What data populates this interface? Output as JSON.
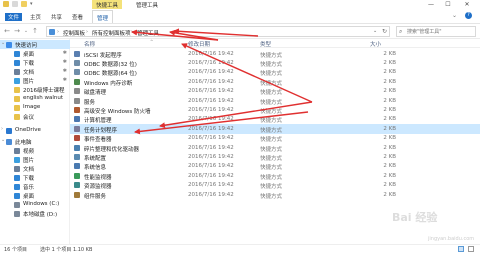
{
  "titlebar": {
    "tools_tab": "快捷工具",
    "title": "管理工具",
    "controls": [
      "—",
      "☐",
      "✕"
    ]
  },
  "ribbon": {
    "tabs": [
      "文件",
      "主页",
      "共享",
      "查看"
    ],
    "manage_tab": "管理"
  },
  "address": {
    "segments": [
      "控制面板",
      "所有控制面板项",
      "管理工具"
    ],
    "search_placeholder": "搜索\"管理工具\""
  },
  "columns": {
    "name": "名称",
    "date": "修改日期",
    "type": "类型",
    "size": "大小"
  },
  "sidebar": {
    "items": [
      {
        "label": "快速访问",
        "pinned": false,
        "selected": true,
        "color": "#3c8be8"
      },
      {
        "label": "桌面",
        "pinned": true,
        "selected": false,
        "color": "#2f86d6"
      },
      {
        "label": "下载",
        "pinned": true,
        "selected": false,
        "color": "#2f86d6"
      },
      {
        "label": "文档",
        "pinned": true,
        "selected": false,
        "color": "#6b7f99"
      },
      {
        "label": "图片",
        "pinned": true,
        "selected": false,
        "color": "#3ba0e0"
      },
      {
        "label": "2016级博士课程",
        "pinned": false,
        "selected": false,
        "color": "#e8c24a"
      },
      {
        "label": "english walnut",
        "pinned": false,
        "selected": false,
        "color": "#e8c24a"
      },
      {
        "label": "Image",
        "pinned": false,
        "selected": false,
        "color": "#e8c24a"
      },
      {
        "label": "会议",
        "pinned": false,
        "selected": false,
        "color": "#e8c24a"
      },
      {
        "label": "OneDrive",
        "pinned": false,
        "selected": false,
        "color": "#2a78d0"
      },
      {
        "label": "此电脑",
        "pinned": false,
        "selected": false,
        "color": "#4a8bd6"
      },
      {
        "label": "视频",
        "pinned": false,
        "selected": false,
        "color": "#6b7f99"
      },
      {
        "label": "图片",
        "pinned": false,
        "selected": false,
        "color": "#3ba0e0"
      },
      {
        "label": "文档",
        "pinned": false,
        "selected": false,
        "color": "#6b7f99"
      },
      {
        "label": "下载",
        "pinned": false,
        "selected": false,
        "color": "#2f86d6"
      },
      {
        "label": "音乐",
        "pinned": false,
        "selected": false,
        "color": "#2f86d6"
      },
      {
        "label": "桌面",
        "pinned": false,
        "selected": false,
        "color": "#2f86d6"
      },
      {
        "label": "Windows (C:)",
        "pinned": false,
        "selected": false,
        "color": "#7a8899"
      },
      {
        "label": "本地磁盘 (D:)",
        "pinned": false,
        "selected": false,
        "color": "#7a8899"
      }
    ]
  },
  "files": [
    {
      "name": "iSCSI 发起程序",
      "date": "2016/7/16 19:42",
      "type": "快捷方式",
      "size": "2 KB",
      "color": "#5a7fb0"
    },
    {
      "name": "ODBC 数据源(32 位)",
      "date": "2016/7/16 19:42",
      "type": "快捷方式",
      "size": "2 KB",
      "color": "#6f8da8"
    },
    {
      "name": "ODBC 数据源(64 位)",
      "date": "2016/7/16 19:42",
      "type": "快捷方式",
      "size": "2 KB",
      "color": "#6f8da8"
    },
    {
      "name": "Windows 内存诊断",
      "date": "2016/7/16 19:42",
      "type": "快捷方式",
      "size": "2 KB",
      "color": "#4d8a4d"
    },
    {
      "name": "磁盘清理",
      "date": "2016/7/16 19:42",
      "type": "快捷方式",
      "size": "2 KB",
      "color": "#8a8a8a"
    },
    {
      "name": "服务",
      "date": "2016/7/16 19:42",
      "type": "快捷方式",
      "size": "2 KB",
      "color": "#8a8a8a"
    },
    {
      "name": "高级安全 Windows 防火墙",
      "date": "2016/7/16 19:42",
      "type": "快捷方式",
      "size": "2 KB",
      "color": "#b0592e"
    },
    {
      "name": "计算机管理",
      "date": "2016/7/16 19:42",
      "type": "快捷方式",
      "size": "2 KB",
      "color": "#4a76b0"
    },
    {
      "name": "任务计划程序",
      "date": "2016/7/16 19:42",
      "type": "快捷方式",
      "size": "2 KB",
      "color": "#7a7a9a",
      "selected": true
    },
    {
      "name": "事件查看器",
      "date": "2016/7/16 19:42",
      "type": "快捷方式",
      "size": "2 KB",
      "color": "#b04a3a"
    },
    {
      "name": "碎片整理和优化驱动器",
      "date": "2016/7/16 19:42",
      "type": "快捷方式",
      "size": "2 KB",
      "color": "#4a80b0"
    },
    {
      "name": "系统配置",
      "date": "2016/7/16 19:42",
      "type": "快捷方式",
      "size": "2 KB",
      "color": "#5a8ab0"
    },
    {
      "name": "系统信息",
      "date": "2016/7/16 19:42",
      "type": "快捷方式",
      "size": "2 KB",
      "color": "#4a7ab0"
    },
    {
      "name": "性能监视器",
      "date": "2016/7/16 19:42",
      "type": "快捷方式",
      "size": "2 KB",
      "color": "#3a9a5a"
    },
    {
      "name": "资源监视器",
      "date": "2016/7/16 19:42",
      "type": "快捷方式",
      "size": "2 KB",
      "color": "#3a8a8a"
    },
    {
      "name": "组件服务",
      "date": "2016/7/16 19:42",
      "type": "快捷方式",
      "size": "2 KB",
      "color": "#a07a3a"
    }
  ],
  "status": {
    "count": "16 个项目",
    "selected": "选中 1 个项目  1.10 KB"
  },
  "annotation_color": "#e03030",
  "watermark": "Bai 经验",
  "watermark_sub": "jingyan.baidu.com"
}
